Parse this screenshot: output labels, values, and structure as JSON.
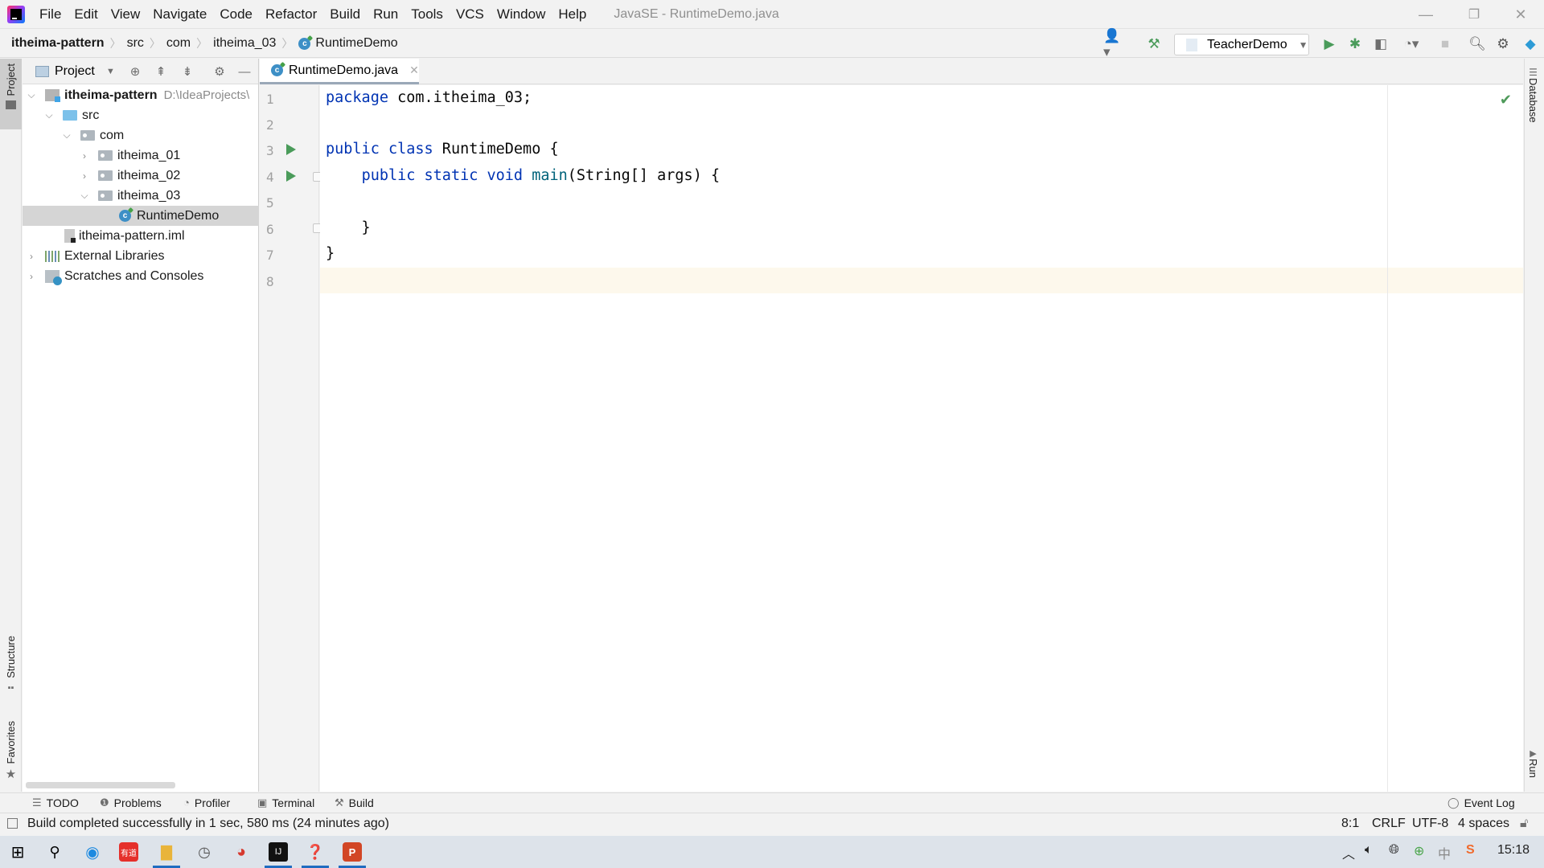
{
  "window": {
    "title": "JavaSE - RuntimeDemo.java",
    "minimize": "—",
    "restore": "❐",
    "close": "✕"
  },
  "menu": [
    "File",
    "Edit",
    "View",
    "Navigate",
    "Code",
    "Refactor",
    "Build",
    "Run",
    "Tools",
    "VCS",
    "Window",
    "Help"
  ],
  "breadcrumb": {
    "items": [
      "itheima-pattern",
      "src",
      "com",
      "itheima_03",
      "RuntimeDemo"
    ],
    "separator": "〉"
  },
  "toolbar": {
    "run_config": "TeacherDemo",
    "colors": {
      "run": "#4a9b5a",
      "build": "#4a9b5a"
    }
  },
  "left_stripe": {
    "project": "Project",
    "structure": "Structure",
    "favorites": "Favorites"
  },
  "right_stripe": {
    "database": "Database",
    "run": "Run"
  },
  "project_panel": {
    "title": "Project",
    "tree": [
      {
        "label": "itheima-pattern",
        "hint": "D:\\IdeaProjects\\",
        "bold": true,
        "expanded": true,
        "type": "module"
      },
      {
        "label": "src",
        "expanded": true,
        "type": "src-folder"
      },
      {
        "label": "com",
        "expanded": true,
        "type": "package"
      },
      {
        "label": "itheima_01",
        "expanded": false,
        "type": "package"
      },
      {
        "label": "itheima_02",
        "expanded": false,
        "type": "package"
      },
      {
        "label": "itheima_03",
        "expanded": true,
        "type": "package"
      },
      {
        "label": "RuntimeDemo",
        "type": "class",
        "selected": true
      },
      {
        "label": "itheima-pattern.iml",
        "type": "iml"
      },
      {
        "label": "External Libraries",
        "expanded": false,
        "type": "libraries"
      },
      {
        "label": "Scratches and Consoles",
        "expanded": false,
        "type": "scratches"
      }
    ]
  },
  "editor": {
    "tab": "RuntimeDemo.java",
    "line_numbers": [
      "1",
      "2",
      "3",
      "4",
      "5",
      "6",
      "7",
      "8"
    ],
    "lines": [
      {
        "tokens": [
          {
            "t": "package",
            "c": "kw"
          },
          {
            "t": " com.itheima_03;"
          }
        ]
      },
      {
        "tokens": []
      },
      {
        "tokens": [
          {
            "t": "public",
            "c": "kw"
          },
          {
            "t": " "
          },
          {
            "t": "class",
            "c": "kw"
          },
          {
            "t": " RuntimeDemo {"
          }
        ]
      },
      {
        "tokens": [
          {
            "t": "    "
          },
          {
            "t": "public",
            "c": "kw"
          },
          {
            "t": " "
          },
          {
            "t": "static",
            "c": "kw"
          },
          {
            "t": " "
          },
          {
            "t": "void",
            "c": "kw"
          },
          {
            "t": " "
          },
          {
            "t": "main",
            "c": "fn"
          },
          {
            "t": "(String[] args) {"
          }
        ]
      },
      {
        "tokens": []
      },
      {
        "tokens": [
          {
            "t": "    }"
          }
        ]
      },
      {
        "tokens": [
          {
            "t": "}"
          }
        ]
      },
      {
        "tokens": []
      }
    ],
    "colors": {
      "keyword": "#0033b3",
      "method": "#00627a",
      "current_line": "#fdf8ec"
    }
  },
  "tool_tabs": [
    "TODO",
    "Problems",
    "Profiler",
    "Terminal",
    "Build"
  ],
  "event_log": "Event Log",
  "status": {
    "message": "Build completed successfully in 1 sec, 580 ms (24 minutes ago)",
    "position": "8:1",
    "line_ending": "CRLF",
    "encoding": "UTF-8",
    "indent": "4 spaces"
  },
  "taskbar": {
    "time": "15:18",
    "ime": "中"
  }
}
